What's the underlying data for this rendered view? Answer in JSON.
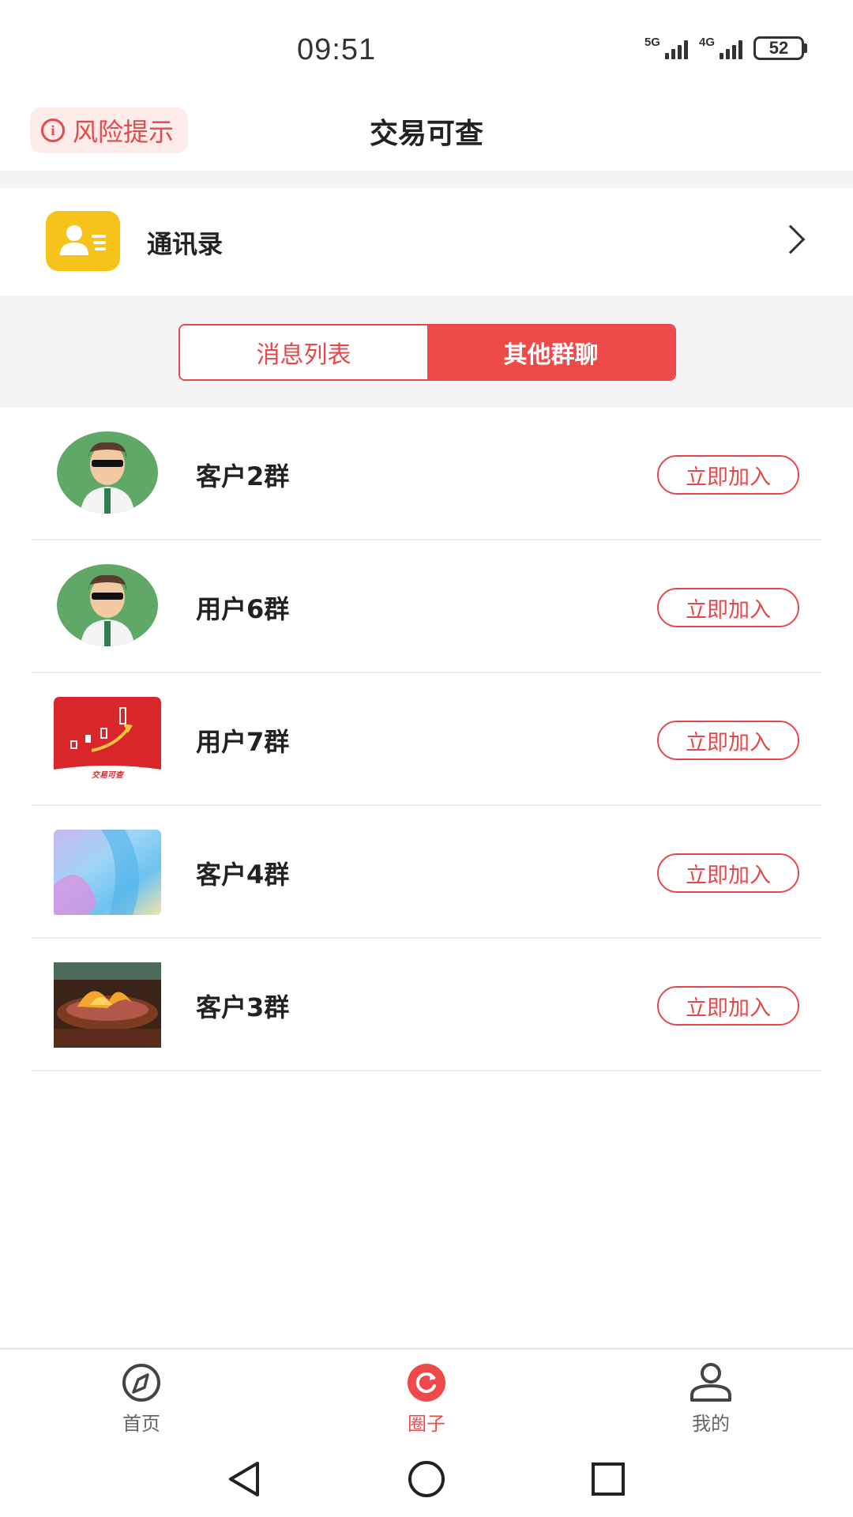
{
  "status_bar": {
    "time": "09:51",
    "signal1_label": "5G",
    "signal2_label": "4G",
    "battery": "52"
  },
  "header": {
    "risk_label": "风险提示",
    "title": "交易可查"
  },
  "contacts": {
    "label": "通讯录",
    "icon": "contacts-card-icon"
  },
  "tabs": [
    {
      "label": "消息列表",
      "active": false
    },
    {
      "label": "其他群聊",
      "active": true
    }
  ],
  "groups": [
    {
      "name": "客户2群",
      "button": "立即加入",
      "avatar": "cartoon-man-avatar"
    },
    {
      "name": "用户6群",
      "button": "立即加入",
      "avatar": "cartoon-man-avatar"
    },
    {
      "name": "用户7群",
      "button": "立即加入",
      "avatar": "red-candlestick-logo",
      "avatar_caption": "交易可查"
    },
    {
      "name": "客户4群",
      "button": "立即加入",
      "avatar": "gradient-wave-image"
    },
    {
      "name": "客户3群",
      "button": "立即加入",
      "avatar": "grill-fire-photo"
    }
  ],
  "bottom_nav": [
    {
      "label": "首页",
      "icon": "compass-icon",
      "active": false
    },
    {
      "label": "圈子",
      "icon": "circle-refresh-icon",
      "active": true
    },
    {
      "label": "我的",
      "icon": "person-icon",
      "active": false
    }
  ],
  "colors": {
    "accent": "#ef4a4a",
    "contacts_icon": "#f7c31a",
    "background_gray": "#f4f4f4"
  }
}
